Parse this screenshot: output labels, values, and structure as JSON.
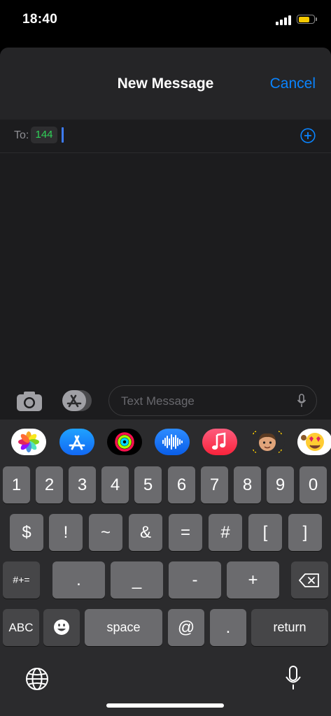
{
  "status_bar": {
    "time": "18:40",
    "battery_color": "#f6c900",
    "battery_level": 0.75
  },
  "compose": {
    "title": "New Message",
    "cancel_label": "Cancel",
    "to_label": "To:",
    "recipient": "144",
    "accent_color": "#0a84ff",
    "recipient_color": "#30d158"
  },
  "input_bar": {
    "camera_icon": "camera-icon",
    "apps_icon": "app-store-icon",
    "placeholder": "Text Message",
    "mic_icon": "microphone-icon"
  },
  "app_strip": [
    {
      "name": "photos-app-icon"
    },
    {
      "name": "app-store-app-icon"
    },
    {
      "name": "activity-app-icon"
    },
    {
      "name": "audio-message-app-icon"
    },
    {
      "name": "music-app-icon"
    },
    {
      "name": "memoji-app-icon"
    },
    {
      "name": "animoji-app-icon"
    }
  ],
  "keyboard": {
    "row1": [
      "1",
      "2",
      "3",
      "4",
      "5",
      "6",
      "7",
      "8",
      "9",
      "0"
    ],
    "row2": [
      "$",
      "!",
      "~",
      "&",
      "=",
      "#",
      "[",
      "]"
    ],
    "row3": {
      "toggle": "#+=",
      "keys": [
        ".",
        "_",
        "-",
        "+"
      ],
      "delete_icon": "delete-backspace-icon"
    },
    "row4": {
      "abc": "ABC",
      "emoji_icon": "emoji-icon",
      "space": "space",
      "at": "@",
      "dot": ".",
      "return": "return"
    },
    "globe_icon": "globe-icon",
    "dictation_icon": "microphone-icon"
  }
}
